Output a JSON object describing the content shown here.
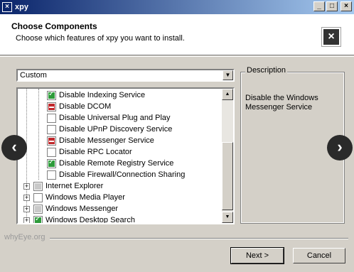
{
  "window": {
    "title": "xpy"
  },
  "header": {
    "title": "Choose Components",
    "subtitle": "Choose which features of xpy you want to install."
  },
  "install_type": {
    "selected": "Custom"
  },
  "components": [
    {
      "label": "Disable Indexing Service",
      "state": "checked"
    },
    {
      "label": "Disable DCOM",
      "state": "red"
    },
    {
      "label": "Disable Universal Plug and Play",
      "state": "unchecked"
    },
    {
      "label": "Disable UPnP Discovery Service",
      "state": "unchecked"
    },
    {
      "label": "Disable Messenger Service",
      "state": "red"
    },
    {
      "label": "Disable RPC Locator",
      "state": "unchecked"
    },
    {
      "label": "Disable Remote Registry Service",
      "state": "checked"
    },
    {
      "label": "Disable Firewall/Connection Sharing",
      "state": "unchecked"
    },
    {
      "label": "Internet Explorer",
      "state": "gray",
      "group": true
    },
    {
      "label": "Windows Media Player",
      "state": "unchecked",
      "group": true
    },
    {
      "label": "Windows Messenger",
      "state": "gray",
      "group": true
    },
    {
      "label": "Windows Desktop Search",
      "state": "checked",
      "group": true
    }
  ],
  "description": {
    "legend": "Description",
    "text": "Disable the Windows Messenger Service"
  },
  "footer": {
    "brand": "whyEye.org",
    "next_label": "Next >",
    "cancel_label": "Cancel"
  }
}
